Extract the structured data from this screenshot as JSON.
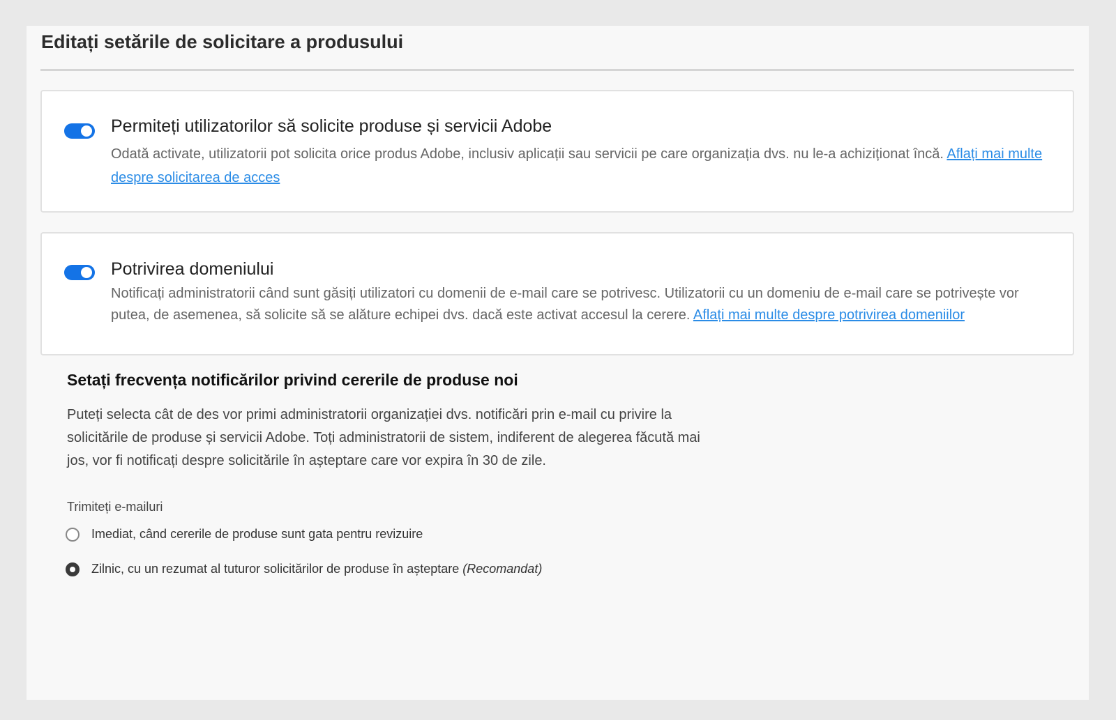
{
  "page": {
    "title": "Editați setările de solicitare a produsului"
  },
  "cards": [
    {
      "toggle_on": true,
      "heading": "Permiteți utilizatorilor să solicite produse și servicii Adobe",
      "description": "Odată activate, utilizatorii pot solicita orice produs Adobe, inclusiv aplicații sau servicii pe care organizația dvs. nu le-a achiziționat încă.",
      "link_text": "Aflați mai multe despre solicitarea de acces"
    },
    {
      "toggle_on": true,
      "heading": "Potrivirea domeniului",
      "description": "Notificați administratorii când sunt găsiți utilizatori cu domenii de e-mail care se potrivesc. Utilizatorii cu un domeniu de e-mail care se potrivește vor putea, de asemenea, să solicite să se alăture echipei dvs. dacă este activat accesul la cerere.",
      "link_text": "Aflați mai multe despre potrivirea domeniilor"
    }
  ],
  "notifications": {
    "title": "Setați frecvența notificărilor privind cererile de produse noi",
    "description": "Puteți selecta cât de des vor primi administratorii organizației dvs. notificări prin e-mail cu privire la solicitările de produse și servicii Adobe. Toți administratorii de sistem, indiferent de alegerea făcută mai jos, vor fi notificați despre solicitările în așteptare care vor expira în 30 de zile.",
    "group_label": "Trimiteți e-mailuri",
    "options": [
      {
        "label": "Imediat, când cererile de produse sunt gata pentru revizuire",
        "suffix": "",
        "selected": false
      },
      {
        "label": "Zilnic, cu un rezumat al tuturor solicitărilor de produse în așteptare",
        "suffix": "(Recomandat)",
        "selected": true
      }
    ]
  },
  "colors": {
    "toggle_on": "#1473e6",
    "link": "#2b8ce6",
    "background": "#e9e9e9",
    "panel": "#f8f8f8"
  }
}
